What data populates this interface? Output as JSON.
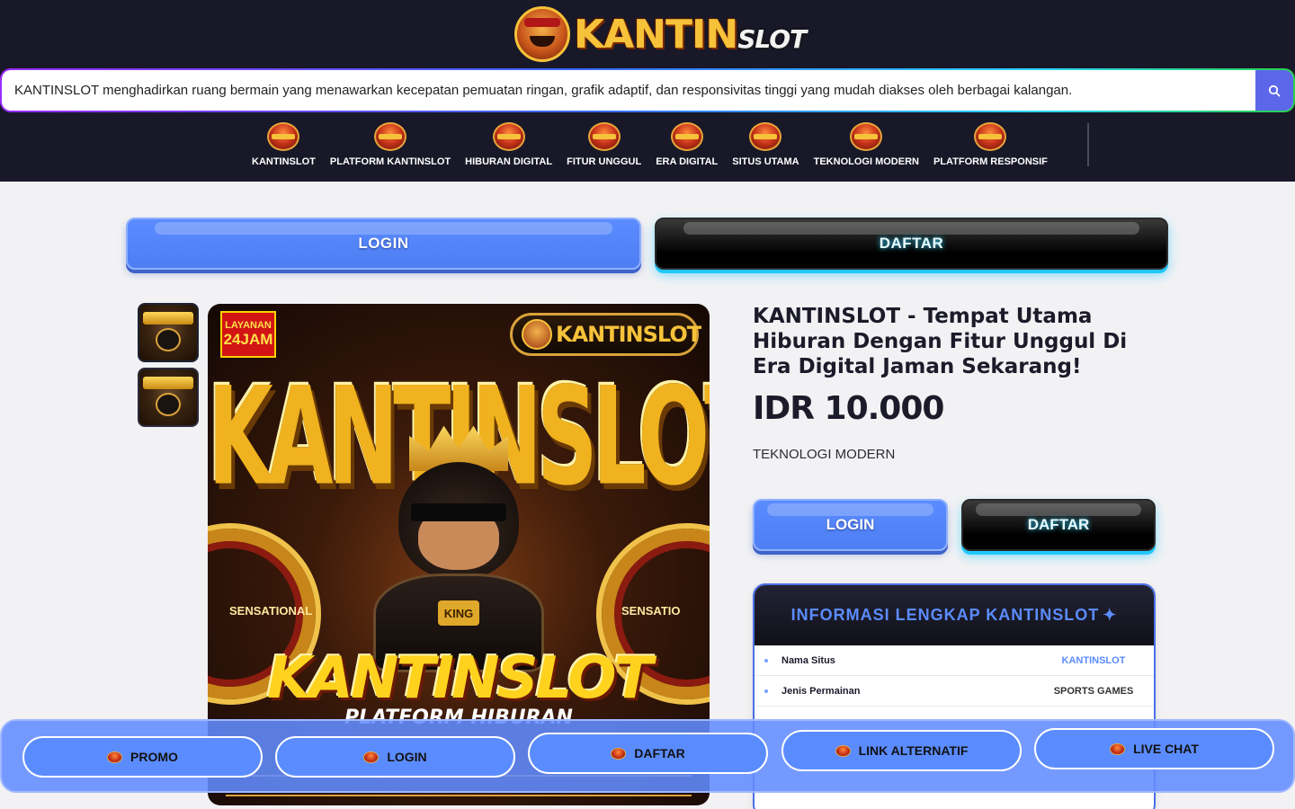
{
  "header": {
    "logo": {
      "main": "KANTIN",
      "small": "SLOT"
    },
    "search": {
      "value": "KANTINSLOT menghadirkan ruang bermain yang menawarkan kecepatan pemuatan ringan, grafik adaptif, dan responsivitas tinggi yang mudah diakses oleh berbagai kalangan.",
      "placeholder": ""
    },
    "nav": [
      {
        "label": "KANTINSLOT"
      },
      {
        "label": "PLATFORM KANTINSLOT"
      },
      {
        "label": "HIBURAN DIGITAL"
      },
      {
        "label": "FITUR UNGGUL"
      },
      {
        "label": "ERA DIGITAL"
      },
      {
        "label": "SITUS UTAMA"
      },
      {
        "label": "TEKNOLOGI MODERN"
      },
      {
        "label": "PLATFORM RESPONSIF"
      }
    ]
  },
  "auth_top": {
    "login": "LOGIN",
    "daftar": "DAFTAR"
  },
  "product": {
    "image": {
      "badge_line1": "LAYANAN",
      "badge_line2": "24JAM",
      "logo_text": "KANTINSLOT",
      "big_text": "KANTINSLOT",
      "ring_left": "SENSATIONAL",
      "ring_right": "SENSATIO",
      "chain_text": "KING",
      "bottom_text": "KANTINSLOT",
      "sub_text": "PLATFORM HIBURAN"
    },
    "title": "KANTINSLOT - Tempat Utama Hiburan Dengan Fitur Unggul Di Era Digital Jaman Sekarang!",
    "price": "IDR 10.000",
    "tagline": "TEKNOLOGI MODERN",
    "login": "LOGIN",
    "daftar": "DAFTAR"
  },
  "info": {
    "title": "INFORMASI LENGKAP KANTINSLOT",
    "sparkle": "✦",
    "rows": [
      {
        "key": "Nama Situs",
        "value": "KANTINSLOT"
      },
      {
        "key": "Jenis Permainan",
        "value": "SPORTS GAMES"
      }
    ]
  },
  "bottom_bar": [
    {
      "label": "PROMO"
    },
    {
      "label": "LOGIN"
    },
    {
      "label": "DAFTAR"
    },
    {
      "label": "LINK ALTERNATIF"
    },
    {
      "label": "LIVE CHAT"
    }
  ],
  "colors": {
    "header_bg": "#181828",
    "accent_blue": "#5b8cff",
    "daftar_glow": "#21c8ff",
    "search_button": "#5b67e8"
  },
  "icons": {
    "search": "search-icon",
    "nav": "kantinslot-badge-icon",
    "bottom": "kantinslot-badge-icon"
  }
}
